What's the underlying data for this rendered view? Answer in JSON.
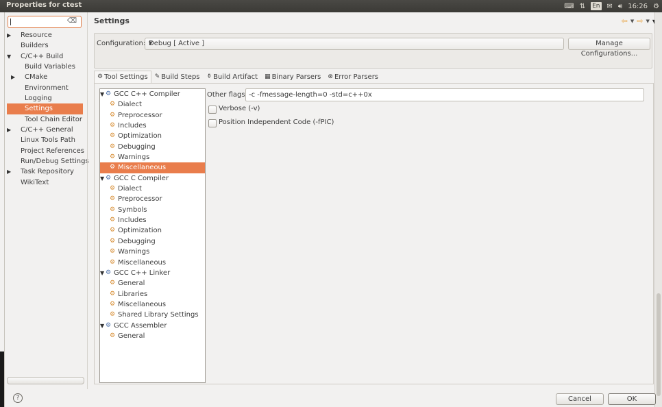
{
  "window": {
    "title": "Properties for ctest"
  },
  "tray": {
    "keyboard_icon": "keyboard-icon",
    "network_icon": "network-icon",
    "lang": "En",
    "volume_icon": "volume-icon",
    "time": "16:26",
    "gear_icon": "gear-icon"
  },
  "filter": {
    "value": "",
    "clear_icon": "clear-icon"
  },
  "nav": {
    "items": [
      {
        "label": "Resource",
        "indent": 1,
        "arrow": "collapsed"
      },
      {
        "label": "Builders",
        "indent": 1,
        "arrow": "none"
      },
      {
        "label": "C/C++ Build",
        "indent": 1,
        "arrow": "expanded"
      },
      {
        "label": "Build Variables",
        "indent": 2,
        "arrow": "none"
      },
      {
        "label": "CMake",
        "indent": 2,
        "arrow": "collapsed"
      },
      {
        "label": "Environment",
        "indent": 2,
        "arrow": "none"
      },
      {
        "label": "Logging",
        "indent": 2,
        "arrow": "none"
      },
      {
        "label": "Settings",
        "indent": 2,
        "arrow": "none",
        "selected": true
      },
      {
        "label": "Tool Chain Editor",
        "indent": 2,
        "arrow": "none"
      },
      {
        "label": "C/C++ General",
        "indent": 1,
        "arrow": "collapsed"
      },
      {
        "label": "Linux Tools Path",
        "indent": 1,
        "arrow": "none"
      },
      {
        "label": "Project References",
        "indent": 1,
        "arrow": "none"
      },
      {
        "label": "Run/Debug Settings",
        "indent": 1,
        "arrow": "none"
      },
      {
        "label": "Task Repository",
        "indent": 1,
        "arrow": "collapsed"
      },
      {
        "label": "WikiText",
        "indent": 1,
        "arrow": "none"
      }
    ]
  },
  "header": {
    "title": "Settings"
  },
  "config": {
    "label": "Configuration:",
    "value": "Debug  [ Active ]",
    "manage_label": "Manage Configurations..."
  },
  "tabs": [
    {
      "label": "Tool Settings",
      "icon": "tool-settings-icon",
      "glyph": "⚙",
      "active": true
    },
    {
      "label": "Build Steps",
      "icon": "build-steps-icon",
      "glyph": "✎"
    },
    {
      "label": "Build Artifact",
      "icon": "build-artifact-icon",
      "glyph": "⚱"
    },
    {
      "label": "Binary Parsers",
      "icon": "binary-parsers-icon",
      "glyph": "▦"
    },
    {
      "label": "Error Parsers",
      "icon": "error-parsers-icon",
      "glyph": "⊗"
    }
  ],
  "tooltree": [
    {
      "label": "GCC C++ Compiler",
      "type": "tool"
    },
    {
      "label": "Dialect",
      "type": "option"
    },
    {
      "label": "Preprocessor",
      "type": "option"
    },
    {
      "label": "Includes",
      "type": "option"
    },
    {
      "label": "Optimization",
      "type": "option"
    },
    {
      "label": "Debugging",
      "type": "option"
    },
    {
      "label": "Warnings",
      "type": "option"
    },
    {
      "label": "Miscellaneous",
      "type": "option",
      "selected": true
    },
    {
      "label": "GCC C Compiler",
      "type": "tool"
    },
    {
      "label": "Dialect",
      "type": "option"
    },
    {
      "label": "Preprocessor",
      "type": "option"
    },
    {
      "label": "Symbols",
      "type": "option"
    },
    {
      "label": "Includes",
      "type": "option"
    },
    {
      "label": "Optimization",
      "type": "option"
    },
    {
      "label": "Debugging",
      "type": "option"
    },
    {
      "label": "Warnings",
      "type": "option"
    },
    {
      "label": "Miscellaneous",
      "type": "option"
    },
    {
      "label": "GCC C++ Linker",
      "type": "tool"
    },
    {
      "label": "General",
      "type": "option"
    },
    {
      "label": "Libraries",
      "type": "option"
    },
    {
      "label": "Miscellaneous",
      "type": "option"
    },
    {
      "label": "Shared Library Settings",
      "type": "option"
    },
    {
      "label": "GCC Assembler",
      "type": "tool"
    },
    {
      "label": "General",
      "type": "option"
    }
  ],
  "options": {
    "other_flags_label": "Other flags",
    "other_flags_value": "-c -fmessage-length=0 -std=c++0x",
    "verbose_label": "Verbose (-v)",
    "verbose_checked": false,
    "pic_label": "Position Independent Code (-fPIC)",
    "pic_checked": false
  },
  "footer": {
    "help_glyph": "?",
    "cancel_label": "Cancel",
    "ok_label": "OK"
  },
  "colors": {
    "accent": "#e97d4c",
    "titlebar": "#3b3a36"
  }
}
